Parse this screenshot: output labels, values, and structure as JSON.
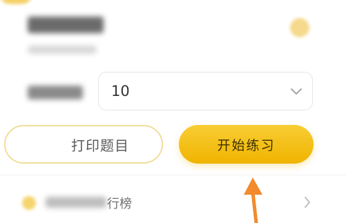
{
  "quiz": {
    "question_count": "10"
  },
  "actions": {
    "print_label": "打印题目",
    "start_label": "开始练习"
  },
  "leaderboard": {
    "visible_label": "行榜"
  },
  "colors": {
    "accent_yellow": "#f2be12",
    "orange_arrow": "#f28a2e"
  }
}
